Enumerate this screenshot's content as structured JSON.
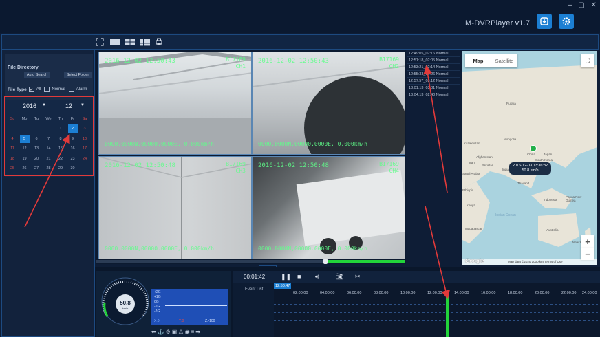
{
  "app": {
    "title": "M-DVRPlayer v1.7",
    "window_controls": "– ▢ ✕"
  },
  "left": {
    "file_directory_label": "File Directory",
    "auto_search_label": "Auto Search",
    "select_folder_label": "Select Folder",
    "file_type_label": "File Type",
    "all_label": "All",
    "normal_label": "Normal",
    "alarm_label": "Alarm",
    "all_checked": true
  },
  "calendar": {
    "year": "2016",
    "month": "12",
    "weekdays": [
      "Su",
      "Mo",
      "Tu",
      "We",
      "Th",
      "Fr",
      "Sa"
    ],
    "days": [
      "1",
      "2",
      "3",
      "4",
      "5",
      "6",
      "7",
      "8",
      "9",
      "10",
      "11",
      "12",
      "13",
      "14",
      "15",
      "16",
      "17",
      "18",
      "19",
      "20",
      "21",
      "22",
      "23",
      "24",
      "25",
      "26",
      "27",
      "28",
      "29",
      "30"
    ],
    "selected_days": [
      "2",
      "5"
    ]
  },
  "cameras": [
    {
      "timestamp": "2016-12-02 12:50:43",
      "id_line1": "B17169",
      "id_line2": "CH1",
      "gps": "0000.0000N,00000.0000E, 0.000km/h"
    },
    {
      "timestamp": "2016-12-02 12:50:43",
      "id_line1": "B17169",
      "id_line2": "CH2",
      "gps": "0000.0000N,00000.0000E, 0.000km/h"
    },
    {
      "timestamp": "2016-12-02 12:50:48",
      "id_line1": "B17169",
      "id_line2": "CH3",
      "gps": "0000.0000N,00000.0000E, 0.000km/h"
    },
    {
      "timestamp": "2016-12-02 12:50:48",
      "id_line1": "B17169",
      "id_line2": "CH4",
      "gps": "0000.0000N,00000.0000E, 0.000km/h"
    }
  ],
  "events": [
    "12:49:05_02:16 Normal",
    "12:51:18_02:05 Normal",
    "12:53:21_02:14 Normal",
    "12:55:33_02:26 Normal",
    "12:57:57_03:12 Normal",
    "13:01:13_03:01 Normal",
    "13:04:13_02:40 Normal"
  ],
  "map": {
    "tab_map": "Map",
    "tab_satellite": "Satellite",
    "tooltip_time": "2016-12-03 13:36:32",
    "tooltip_speed": "50.8 km/h",
    "labels": [
      "Russia",
      "Kazakhstan",
      "Mongolia",
      "China",
      "Japan",
      "South Korea",
      "India",
      "Pakistan",
      "Afghanistan",
      "Iran",
      "Thailand",
      "Saudi Arabia",
      "Ethiopia",
      "Kenya",
      "Madagascar",
      "Indonesia",
      "Papua New Guinea",
      "Australia",
      "Indian Ocean",
      "New Zealand"
    ],
    "footer": "Map data ©2020   1000 km   Terms of Use",
    "google": "Google",
    "zoom_in": "+",
    "zoom_out": "−"
  },
  "gauge": {
    "speed": "50.8",
    "unit": "km/h",
    "gsensor_labels": [
      "+2G",
      "+1G",
      "0G",
      "-1G",
      "-2G"
    ],
    "x_label": "X:0",
    "y_label": "Y:0",
    "z_label": "Z:-100"
  },
  "playback": {
    "time": "00:01:42",
    "event_list_label": "Event List",
    "current_time": "12:50:47",
    "timeline_labels": [
      "02:00:00",
      "04:00:00",
      "06:00:00",
      "08:00:00",
      "10:00:00",
      "12:00:00",
      "14:00:00",
      "16:00:00",
      "18:00:00",
      "20:00:00",
      "22:00:00",
      "24:00:00"
    ]
  }
}
